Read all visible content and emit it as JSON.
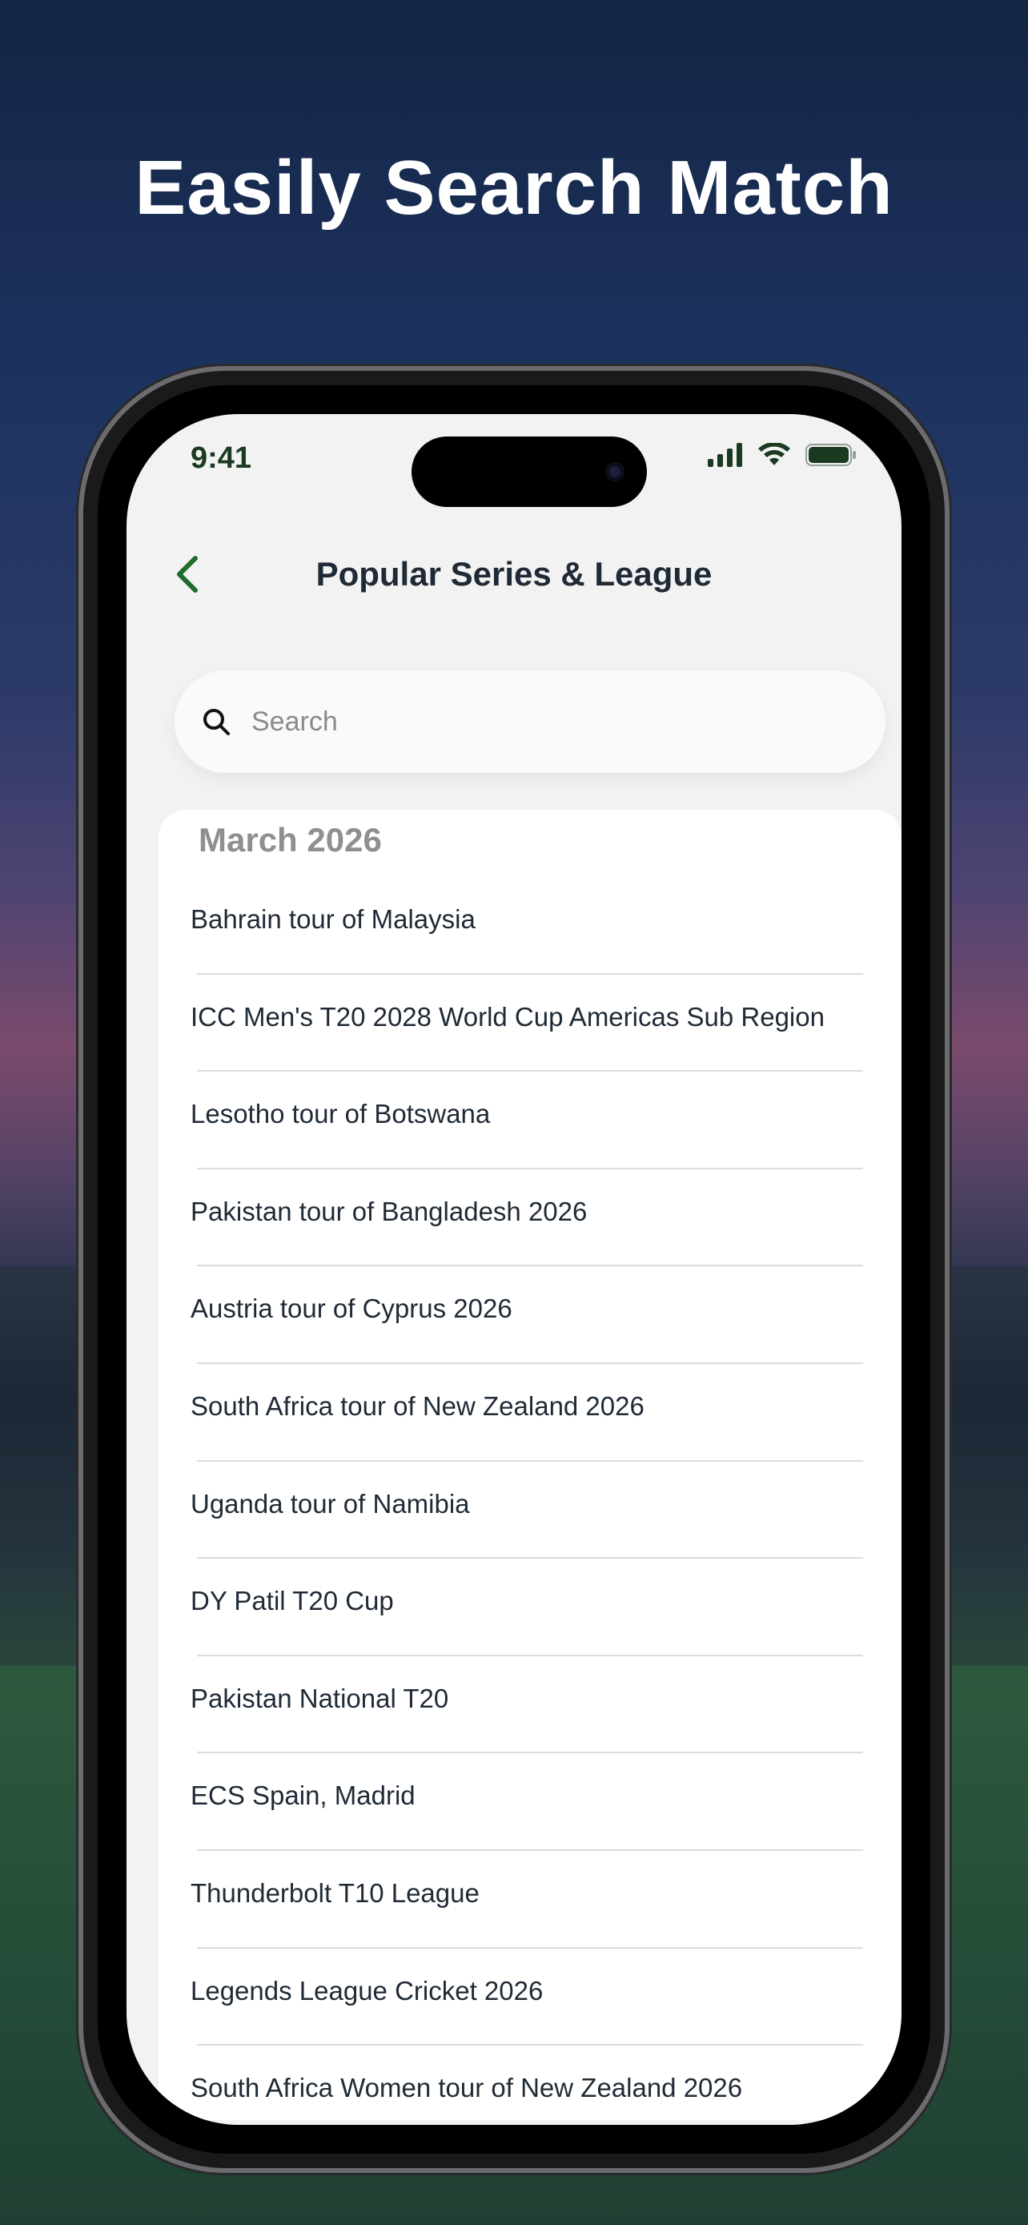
{
  "headline": "Easily Search Match",
  "status_bar": {
    "time": "9:41"
  },
  "header": {
    "title": "Popular Series & League"
  },
  "search": {
    "placeholder": "Search",
    "value": ""
  },
  "section": {
    "month": "March 2026"
  },
  "series": [
    "Bahrain tour of Malaysia",
    "ICC Men's T20 2028 World Cup Americas Sub Region",
    "Lesotho tour of Botswana",
    "Pakistan tour of Bangladesh 2026",
    "Austria tour of Cyprus 2026",
    "South Africa tour of New Zealand 2026",
    "Uganda tour of Namibia",
    "DY Patil T20 Cup",
    "Pakistan National T20",
    "ECS Spain, Madrid",
    "Thunderbolt T10 League",
    "Legends League Cricket 2026",
    "South Africa Women tour of New Zealand 2026"
  ],
  "colors": {
    "accent": "#1e6b2a",
    "title": "#1f2a36",
    "month": "#8f8f8f"
  },
  "icons": {
    "back": "chevron-left-icon",
    "search": "magnifier-icon",
    "signal": "cellular-signal-icon",
    "wifi": "wifi-icon",
    "battery": "battery-icon"
  }
}
